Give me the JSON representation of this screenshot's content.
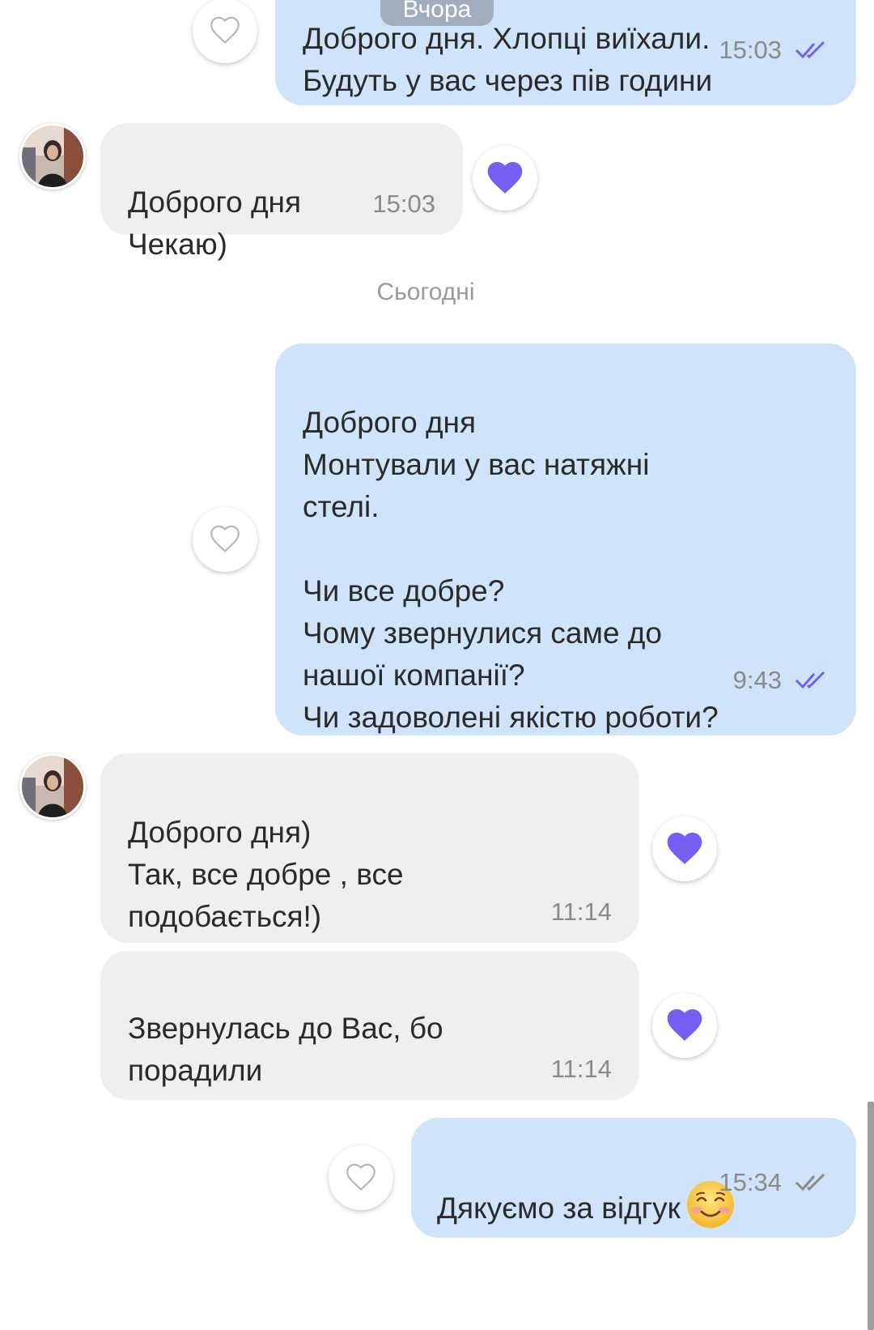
{
  "theme": {
    "outgoing_bubble": "#cfe3fa",
    "incoming_bubble": "#efefef",
    "accent": "#7360f2"
  },
  "floating_date": "Вчора",
  "messages": [
    {
      "direction": "out",
      "text": "Доброго дня. Хлопці виїхали.\nБудуть у вас через пів години",
      "time": "15:03",
      "read": true,
      "liked": false
    },
    {
      "direction": "in",
      "text": "Доброго дня\nЧекаю)",
      "time": "15:03",
      "liked": true
    },
    {
      "direction": "out",
      "text": "Доброго дня\nМонтували у вас натяжні\nстелі.\n\nЧи все добре?\nЧому звернулися саме до\nнашої компанії?\nЧи задоволені якістю роботи?",
      "time": "9:43",
      "read": true,
      "liked": false
    },
    {
      "direction": "in",
      "text": "Доброго дня)\nТак, все добре , все\nподобається!)",
      "time": "11:14",
      "liked": true
    },
    {
      "direction": "in",
      "text": "Звернулась до Вас, бо\nпорадили",
      "time": "11:14",
      "liked": true
    },
    {
      "direction": "out",
      "text": "Дякуємо за відгук",
      "emoji": "smiling-face-emoji",
      "time": "15:34",
      "read": true,
      "liked": false
    }
  ],
  "date_separator": "Сьогодні",
  "icons": {
    "like_empty": "heart-outline-icon",
    "like_filled": "heart-filled-icon",
    "read_status": "double-check-icon",
    "avatar": "contact-avatar"
  }
}
